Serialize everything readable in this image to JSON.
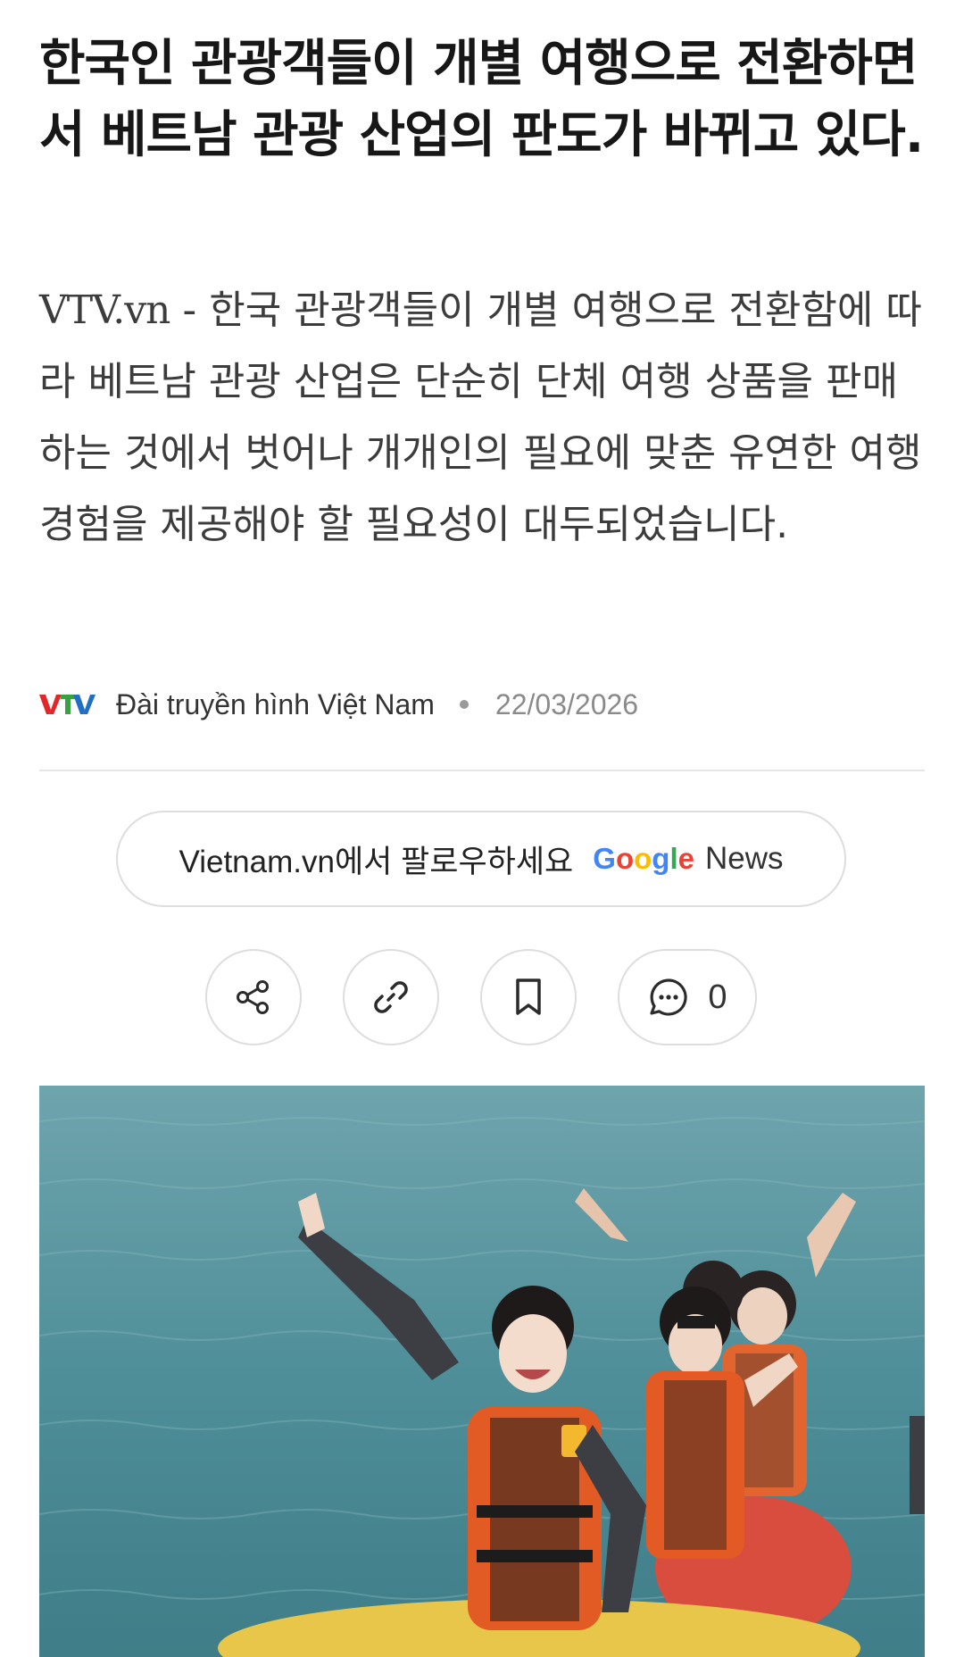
{
  "article": {
    "headline": "한국인 관광객들이 개별 여행으로 전환하면서 베트남 관광 산업의 판도가 바뀌고 있다.",
    "summary_source": "VTV.vn",
    "summary_separator": " - ",
    "summary_text": "한국 관광객들이 개별 여행으로 전환함에 따라 베트남 관광 산업은 단순히 단체 여행 상품을 판매하는 것에서 벗어나 개개인의 필요에 맞춘 유연한 여행 경험을 제공해야 할 필요성이 대두되었습니다."
  },
  "meta": {
    "logo_icon": "vtv-logo-icon",
    "publisher": "Đài truyền hình Việt Nam",
    "date": "22/03/2026"
  },
  "follow": {
    "label": "Vietnam.vn에서 팔로우하세요",
    "google_letters": [
      "G",
      "o",
      "o",
      "g",
      "l",
      "e"
    ],
    "google_colors": [
      "#4285F4",
      "#EA4335",
      "#FBBC05",
      "#4285F4",
      "#34A853",
      "#EA4335"
    ],
    "news_label": "News"
  },
  "actions": {
    "share_icon": "share-icon",
    "link_icon": "link-icon",
    "bookmark_icon": "bookmark-icon",
    "comment_icon": "comment-icon",
    "comment_count": "0"
  },
  "image": {
    "description_icon": "photo-tourists-banana-boat"
  },
  "colors": {
    "headline": "#171717",
    "body": "#3c3c3c",
    "meta_date": "#8a8a8a",
    "border": "#dddddd",
    "vtv_red": "#e3262a",
    "vtv_green": "#3aa142",
    "vtv_blue": "#1f6fc4"
  }
}
